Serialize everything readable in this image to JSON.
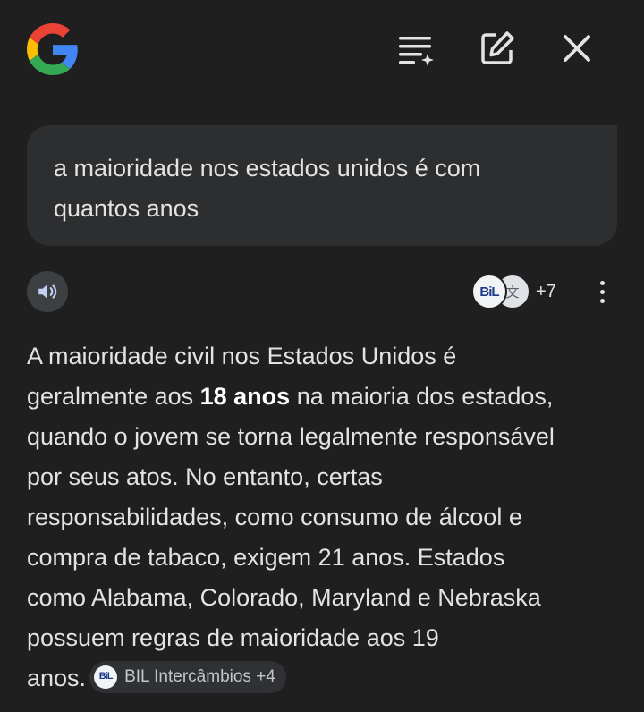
{
  "header": {
    "logo": "google-g-icon",
    "actions": [
      {
        "name": "activity-icon"
      },
      {
        "name": "new-chat-icon"
      },
      {
        "name": "close-icon"
      }
    ]
  },
  "query": {
    "line1": "a maioridade nos estados unidos é com",
    "line2": "quantos anos"
  },
  "response_toolbar": {
    "speaker_icon": "volume-icon",
    "source_avatar_1": "BiL",
    "source_avatar_2": "文",
    "source_count": "+7",
    "more_icon": "more-vert-icon"
  },
  "answer": {
    "lines": [
      "A maioridade civil nos Estados Unidos é",
      "geralmente aos ",
      "18 anos",
      " na maioria dos estados,",
      "quando o jovem se torna legalmente responsável",
      "por seus atos. No entanto, certas",
      "responsabilidades, como consumo de álcool e",
      "compra de tabaco, exigem 21 anos. Estados",
      "como Alabama, Colorado, Maryland e Nebraska",
      "possuem regras de maioridade aos 19",
      "anos."
    ],
    "chip": {
      "avatar": "BiL",
      "label": "BIL Intercâmbios +4"
    }
  },
  "colors": {
    "background": "#1f1f1f",
    "bubble": "#2d2e30",
    "text": "#e3e3e3"
  }
}
